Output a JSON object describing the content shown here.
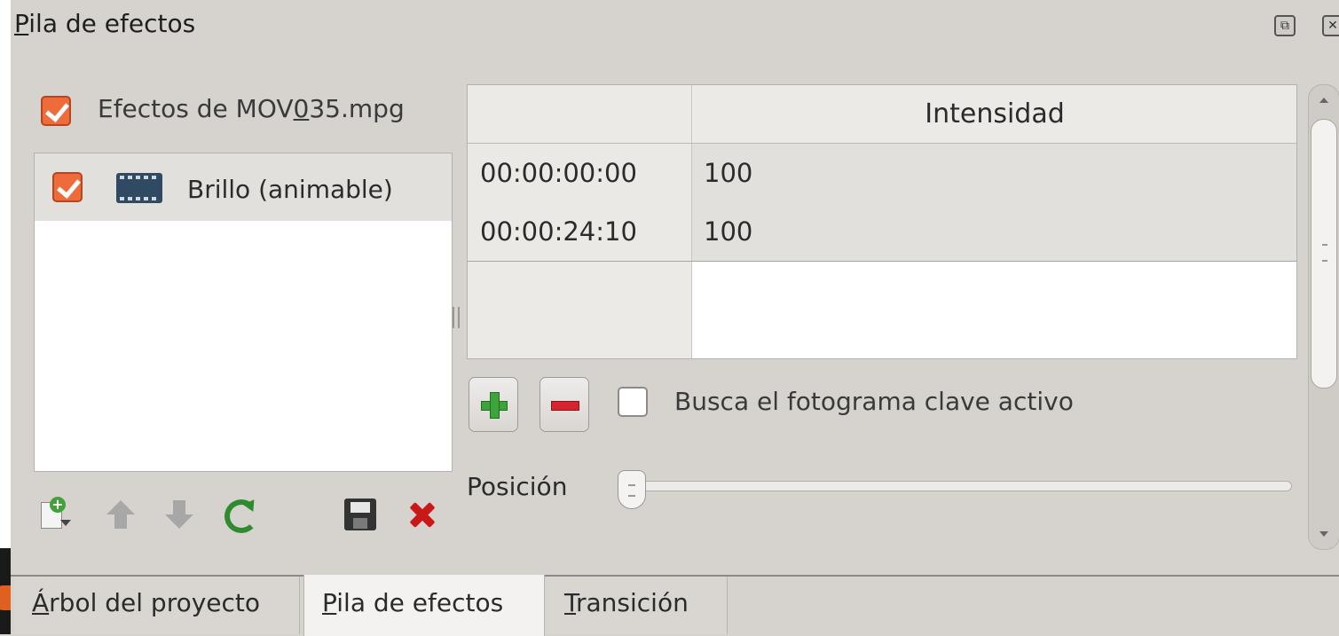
{
  "dock": {
    "title_first": "P",
    "title_rest": "ila de efectos",
    "float_icon": "restore-window-icon",
    "close_icon": "close-icon"
  },
  "effects": {
    "header_prefix": "Efectos de MOV",
    "header_underlined": "0",
    "header_suffix": "35.mpg",
    "header_checked": true,
    "items": [
      {
        "label": "Brillo (animable)",
        "checked": true,
        "icon": "film-icon"
      }
    ]
  },
  "toolbar": {
    "icons": [
      "add-effect-icon",
      "move-up-icon",
      "move-down-icon",
      "reload-icon",
      "save-icon",
      "delete-icon"
    ]
  },
  "keyframes": {
    "column_header": "Intensidad",
    "rows": [
      {
        "time": "00:00:00:00",
        "value": "100"
      },
      {
        "time": "00:00:24:10",
        "value": "100"
      }
    ]
  },
  "controls": {
    "add_icon": "plus-icon",
    "remove_icon": "minus-icon",
    "seek_label": "Busca el fotograma clave activo",
    "seek_checked": false,
    "position_label": "Posición",
    "position_value": 0
  },
  "tabs": [
    {
      "first": "Á",
      "rest": "rbol del proyecto",
      "active": false
    },
    {
      "first": "P",
      "rest": "ila de efectos",
      "active": true
    },
    {
      "first": "T",
      "rest": "ransición",
      "active": false
    }
  ],
  "colors": {
    "checkbox_accent": "#ee6b3c",
    "add_green": "#3da43b",
    "remove_red": "#d6232e",
    "panel_bg": "#d6d3cf"
  }
}
